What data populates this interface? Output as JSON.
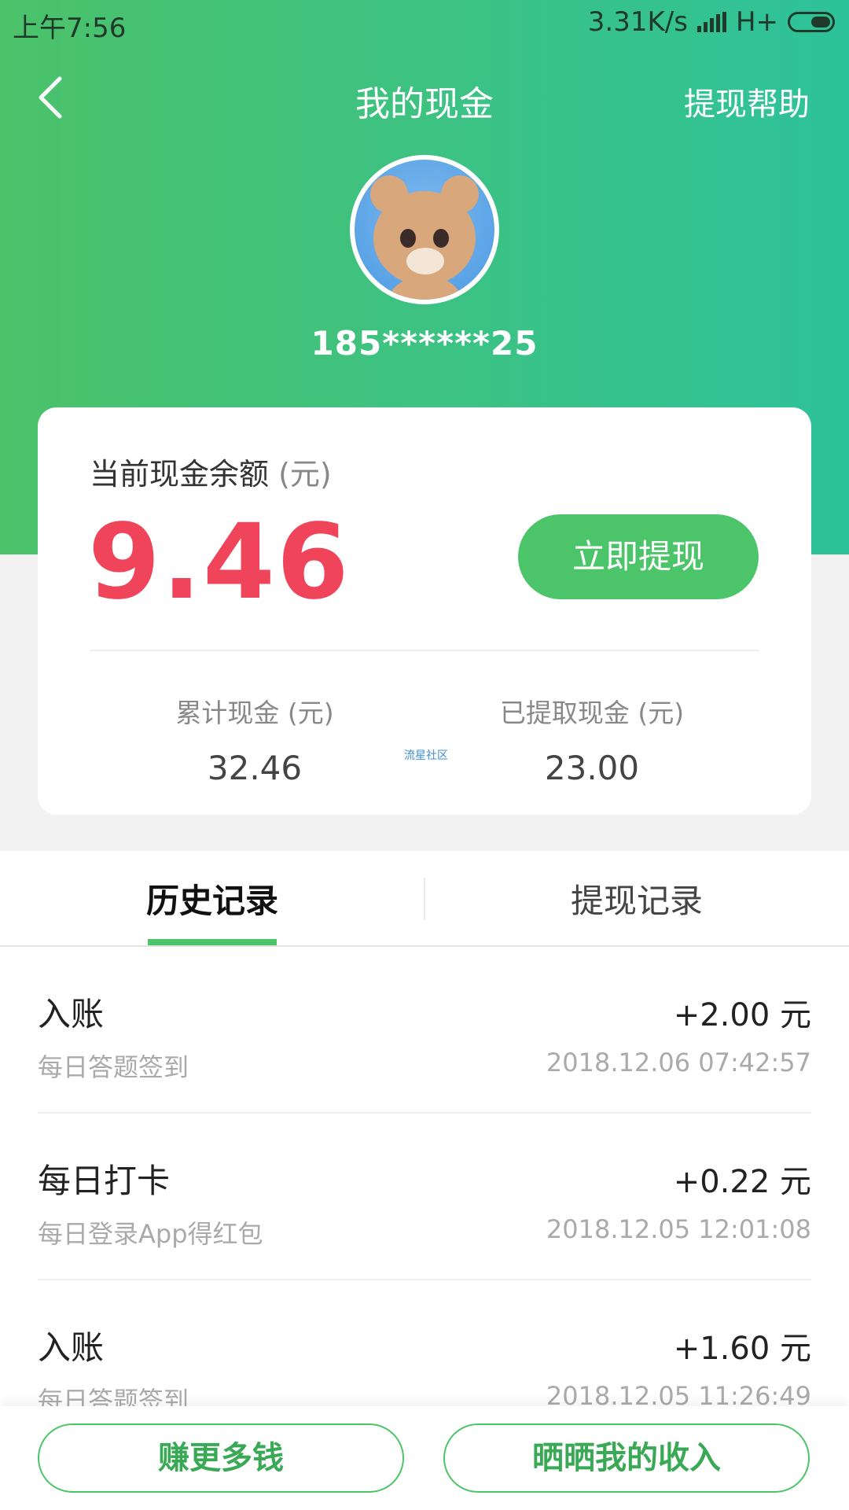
{
  "status_bar": {
    "time": "上午7:56",
    "network_speed": "3.31K/s",
    "network_type": "H+"
  },
  "header": {
    "title": "我的现金",
    "help_label": "提现帮助",
    "username": "185******25"
  },
  "balance_card": {
    "label": "当前现金余额",
    "unit": "(元)",
    "amount": "9.46",
    "withdraw_label": "立即提现",
    "total_label": "累计现金 (元)",
    "total_value": "32.46",
    "withdrawn_label": "已提取现金 (元)",
    "withdrawn_value": "23.00",
    "watermark": "流星社区"
  },
  "tabs": [
    {
      "label": "历史记录",
      "active": true
    },
    {
      "label": "提现记录",
      "active": false
    }
  ],
  "records": [
    {
      "title": "入账",
      "amount": "+2.00 元",
      "subtitle": "每日答题签到",
      "time": "2018.12.06 07:42:57"
    },
    {
      "title": "每日打卡",
      "amount": "+0.22 元",
      "subtitle": "每日登录App得红包",
      "time": "2018.12.05 12:01:08"
    },
    {
      "title": "入账",
      "amount": "+1.60 元",
      "subtitle": "每日答题签到",
      "time": "2018.12.05 11:26:49"
    }
  ],
  "bottom": {
    "earn_more_label": "赚更多钱",
    "share_income_label": "晒晒我的收入"
  },
  "colors": {
    "accent_green": "#4cc56a",
    "amount_red": "#f0445a"
  }
}
